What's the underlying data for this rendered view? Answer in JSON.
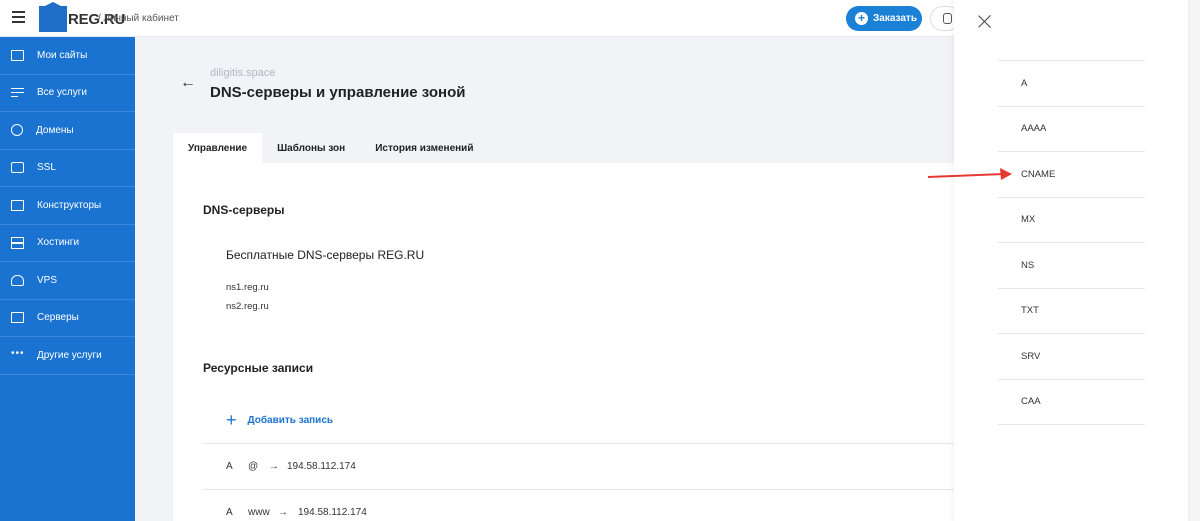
{
  "header": {
    "logo_text": "REG.RU",
    "breadcrumb": "/ Личный кабинет",
    "order_label": "Заказать"
  },
  "sidebar": {
    "items": [
      {
        "label": "Мои сайты",
        "icon": "sites-icon"
      },
      {
        "label": "Все услуги",
        "icon": "services-icon"
      },
      {
        "label": "Домены",
        "icon": "globe-icon"
      },
      {
        "label": "SSL",
        "icon": "ssl-icon"
      },
      {
        "label": "Конструкторы",
        "icon": "builder-icon"
      },
      {
        "label": "Хостинги",
        "icon": "hosting-icon"
      },
      {
        "label": "VPS",
        "icon": "cloud-icon"
      },
      {
        "label": "Серверы",
        "icon": "server-icon"
      },
      {
        "label": "Другие услуги",
        "icon": "more-icon"
      }
    ]
  },
  "main": {
    "domain": "diligitis.space",
    "title": "DNS-серверы и управление зоной",
    "tabs": [
      {
        "label": "Управление",
        "active": true
      },
      {
        "label": "Шаблоны зон",
        "active": false
      },
      {
        "label": "История изменений",
        "active": false
      }
    ],
    "dns_heading": "DNS-серверы",
    "dns_free": "Бесплатные DNS-серверы REG.RU",
    "ns": [
      "ns1.reg.ru",
      "ns2.reg.ru"
    ],
    "records_heading": "Ресурсные записи",
    "add_record": "Добавить запись",
    "records": [
      {
        "type": "A",
        "host": "@",
        "arrow": "→",
        "value": "194.58.112.174"
      },
      {
        "type": "A",
        "host": "www",
        "arrow": "→",
        "value": "194.58.112.174"
      }
    ]
  },
  "record_types": [
    "A",
    "AAAA",
    "CNAME",
    "MX",
    "NS",
    "TXT",
    "SRV",
    "CAA"
  ],
  "colors": {
    "accent": "#1a73d0",
    "annotation_arrow": "#e53935"
  }
}
